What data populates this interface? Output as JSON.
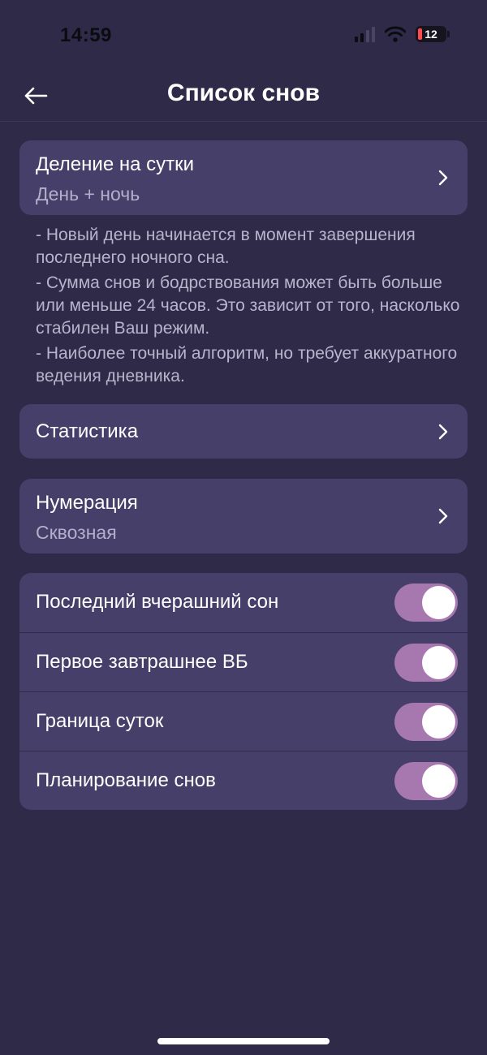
{
  "status_bar": {
    "time": "14:59",
    "battery_level": "12",
    "battery_color": "#ff4b4b"
  },
  "header": {
    "title": "Список снов",
    "back_icon": "arrow-left-icon"
  },
  "day_division": {
    "title": "Деление на сутки",
    "value": "День + ночь",
    "description": [
      "- Новый день начинается в момент завершения последнего ночного сна.",
      "- Сумма снов и бодрствования может быть больше или меньше 24 часов. Это зависит от того, насколько стабилен Ваш режим.",
      "- Наиболее точный алгоритм, но требует аккуратного ведения дневника."
    ]
  },
  "statistics": {
    "title": "Статистика"
  },
  "numbering": {
    "title": "Нумерация",
    "value": "Сквозная"
  },
  "toggles": [
    {
      "label": "Последний вчерашний сон",
      "on": true
    },
    {
      "label": "Первое завтрашнее ВБ",
      "on": true
    },
    {
      "label": "Граница суток",
      "on": true
    },
    {
      "label": "Планирование снов",
      "on": true
    }
  ],
  "colors": {
    "background": "#2e2a48",
    "card": "#463f69",
    "toggle_on": "#a777b0",
    "secondary_text": "#b3aeca"
  }
}
